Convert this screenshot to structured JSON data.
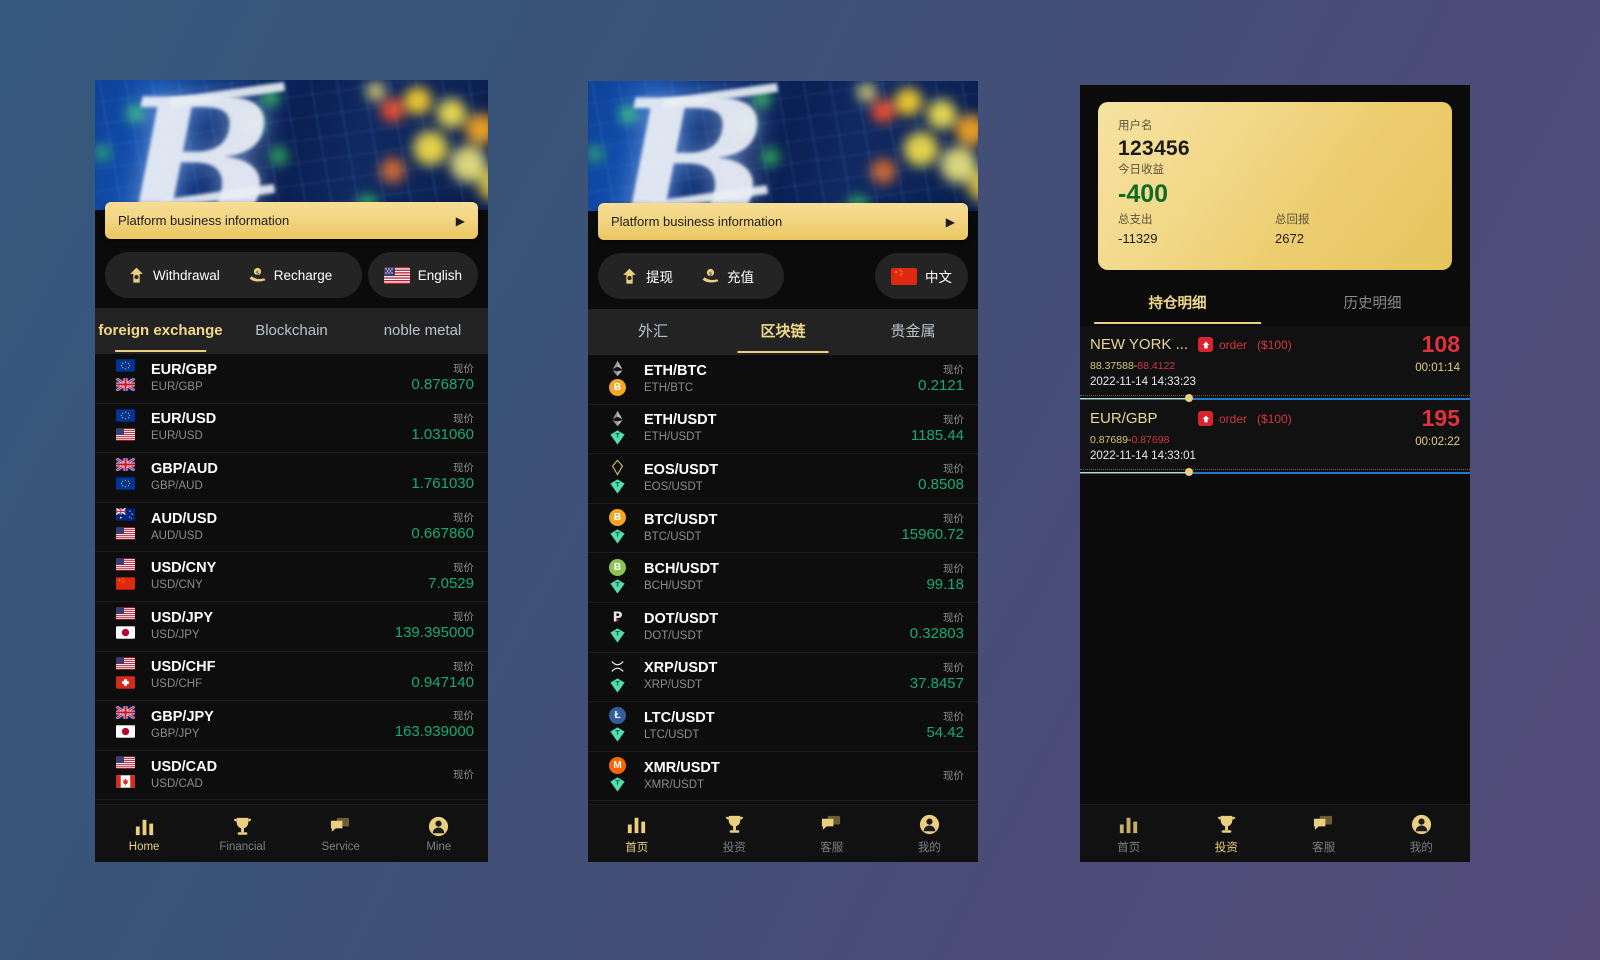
{
  "theme": {
    "gold": "#e9cf7f",
    "green": "#19a974",
    "red": "#d0383f",
    "panel_bg": "#0d0d0d",
    "page_bg_from": "#34597c",
    "page_bg_to": "#544b79"
  },
  "panel1": {
    "banner_alt": "bitcoin-trading-board-banner",
    "promo": {
      "text": "Platform business information",
      "arrow": "▶",
      "icon": "chevron-right-icon"
    },
    "actions": {
      "withdrawal": {
        "label": "Withdrawal",
        "icon": "withdraw-arrow-icon"
      },
      "recharge": {
        "label": "Recharge",
        "icon": "recharge-hand-icon"
      },
      "language": {
        "label": "English",
        "flag": "us-flag-icon"
      }
    },
    "tabs": [
      {
        "label": "foreign exchange",
        "active": true
      },
      {
        "label": "Blockchain",
        "active": false
      },
      {
        "label": "noble metal",
        "active": false
      }
    ],
    "price_label": "现价",
    "rows": [
      {
        "name": "EUR/GBP",
        "sub": "EUR/GBP",
        "price": "0.876870",
        "icon_a": "eu-flag-icon",
        "icon_b": "gb-flag-icon"
      },
      {
        "name": "EUR/USD",
        "sub": "EUR/USD",
        "price": "1.031060",
        "icon_a": "eu-flag-icon",
        "icon_b": "us-flag-icon"
      },
      {
        "name": "GBP/AUD",
        "sub": "GBP/AUD",
        "price": "1.761030",
        "icon_a": "gb-flag-icon",
        "icon_b": "eu-flag-icon"
      },
      {
        "name": "AUD/USD",
        "sub": "AUD/USD",
        "price": "0.667860",
        "icon_a": "au-flag-icon",
        "icon_b": "us-flag-icon"
      },
      {
        "name": "USD/CNY",
        "sub": "USD/CNY",
        "price": "7.0529",
        "icon_a": "us-flag-icon",
        "icon_b": "cn-flag-icon"
      },
      {
        "name": "USD/JPY",
        "sub": "USD/JPY",
        "price": "139.395000",
        "icon_a": "us-flag-icon",
        "icon_b": "jp-flag-icon"
      },
      {
        "name": "USD/CHF",
        "sub": "USD/CHF",
        "price": "0.947140",
        "icon_a": "us-flag-icon",
        "icon_b": "ch-flag-icon"
      },
      {
        "name": "GBP/JPY",
        "sub": "GBP/JPY",
        "price": "163.939000",
        "icon_a": "gb-flag-icon",
        "icon_b": "jp-flag-icon"
      },
      {
        "name": "USD/CAD",
        "sub": "USD/CAD",
        "price": "",
        "icon_a": "us-flag-icon",
        "icon_b": "ca-flag-icon"
      }
    ],
    "nav": [
      {
        "label": "Home",
        "icon": "bar-chart-icon",
        "active": true
      },
      {
        "label": "Financial",
        "icon": "trophy-icon",
        "active": false
      },
      {
        "label": "Service",
        "icon": "chat-icon",
        "active": false
      },
      {
        "label": "Mine",
        "icon": "user-icon",
        "active": false
      }
    ]
  },
  "panel2": {
    "promo": {
      "text": "Platform business information",
      "arrow": "▶",
      "icon": "chevron-right-icon"
    },
    "actions": {
      "withdrawal": {
        "label": "提现",
        "icon": "withdraw-arrow-icon"
      },
      "recharge": {
        "label": "充值",
        "icon": "recharge-hand-icon"
      },
      "language": {
        "label": "中文",
        "flag": "cn-flag-icon"
      }
    },
    "tabs": [
      {
        "label": "外汇",
        "active": false
      },
      {
        "label": "区块链",
        "active": true
      },
      {
        "label": "贵金属",
        "active": false
      }
    ],
    "price_label": "现价",
    "rows": [
      {
        "name": "ETH/BTC",
        "sub": "ETH/BTC",
        "price": "0.2121",
        "icon_a": "eth-icon",
        "icon_b": "btc-icon"
      },
      {
        "name": "ETH/USDT",
        "sub": "ETH/USDT",
        "price": "1185.44",
        "icon_a": "eth-icon",
        "icon_b": "usdt-icon"
      },
      {
        "name": "EOS/USDT",
        "sub": "EOS/USDT",
        "price": "0.8508",
        "icon_a": "eos-icon",
        "icon_b": "usdt-icon"
      },
      {
        "name": "BTC/USDT",
        "sub": "BTC/USDT",
        "price": "15960.72",
        "icon_a": "btc-icon",
        "icon_b": "usdt-icon"
      },
      {
        "name": "BCH/USDT",
        "sub": "BCH/USDT",
        "price": "99.18",
        "icon_a": "bch-icon",
        "icon_b": "usdt-icon"
      },
      {
        "name": "DOT/USDT",
        "sub": "DOT/USDT",
        "price": "0.32803",
        "icon_a": "dot-icon",
        "icon_b": "usdt-icon"
      },
      {
        "name": "XRP/USDT",
        "sub": "XRP/USDT",
        "price": "37.8457",
        "icon_a": "xrp-icon",
        "icon_b": "usdt-icon"
      },
      {
        "name": "LTC/USDT",
        "sub": "LTC/USDT",
        "price": "54.42",
        "icon_a": "ltc-icon",
        "icon_b": "usdt-icon"
      },
      {
        "name": "XMR/USDT",
        "sub": "XMR/USDT",
        "price": "",
        "icon_a": "xmr-icon",
        "icon_b": "usdt-icon"
      }
    ],
    "nav": [
      {
        "label": "首页",
        "icon": "bar-chart-icon",
        "active": true
      },
      {
        "label": "投资",
        "icon": "trophy-icon",
        "active": false
      },
      {
        "label": "客服",
        "icon": "chat-icon",
        "active": false
      },
      {
        "label": "我的",
        "icon": "user-icon",
        "active": false
      }
    ]
  },
  "panel3": {
    "card": {
      "username_label": "用户名",
      "username_value": "123456",
      "profit_label": "今日收益",
      "profit_value": "-400",
      "spend_label": "总支出",
      "spend_value": "-11329",
      "return_label": "总回报",
      "return_value": "2672"
    },
    "tabs": [
      {
        "label": "持仓明细",
        "active": true
      },
      {
        "label": "历史明细",
        "active": false
      }
    ],
    "orders": [
      {
        "symbol": "NEW YORK ...",
        "direction_icon": "arrow-up-badge-icon",
        "kind": "order",
        "amount": "($100)",
        "open_price": "88.37588-",
        "close_price": "88.4122",
        "timestamp": "2022-11-14 14:33:23",
        "value": "108",
        "countdown": "00:01:14"
      },
      {
        "symbol": "EUR/GBP",
        "direction_icon": "arrow-up-badge-icon",
        "kind": "order",
        "amount": "($100)",
        "open_price": "0.87689-",
        "close_price": "0.87698",
        "timestamp": "2022-11-14 14:33:01",
        "value": "195",
        "countdown": "00:02:22"
      }
    ],
    "nav": [
      {
        "label": "首页",
        "icon": "bar-chart-icon",
        "active": false
      },
      {
        "label": "投资",
        "icon": "trophy-icon",
        "active": true
      },
      {
        "label": "客服",
        "icon": "chat-icon",
        "active": false
      },
      {
        "label": "我的",
        "icon": "user-icon",
        "active": false
      }
    ]
  }
}
